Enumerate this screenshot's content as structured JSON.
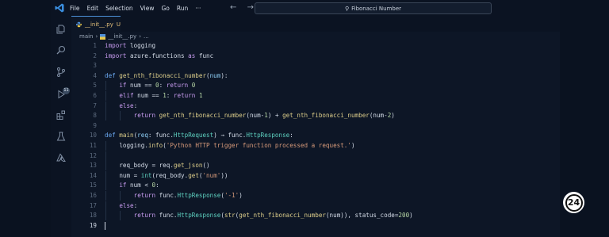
{
  "menu": [
    "File",
    "Edit",
    "Selection",
    "View",
    "Go",
    "Run",
    "···"
  ],
  "nav": {
    "back": "←",
    "forward": "→"
  },
  "search": {
    "text": "Fibonacci Number",
    "icon": "search-icon"
  },
  "activity": {
    "badge": "11",
    "icons": [
      "explorer-icon",
      "search-icon",
      "source-control-icon",
      "run-debug-icon",
      "extensions-icon",
      "testing-icon",
      "azure-icon"
    ]
  },
  "tab": {
    "label": "__init__.py",
    "status": "U"
  },
  "breadcrumb": {
    "folder": "main",
    "file": "__init__.py",
    "tail": "..."
  },
  "editor": {
    "active_line": 19,
    "lines": [
      {
        "n": 1,
        "indent": 0,
        "tokens": [
          [
            "k",
            "import"
          ],
          [
            "o",
            " logging"
          ]
        ]
      },
      {
        "n": 2,
        "indent": 0,
        "tokens": [
          [
            "k",
            "import"
          ],
          [
            "o",
            " azure.functions "
          ],
          [
            "k",
            "as"
          ],
          [
            "o",
            " func"
          ]
        ]
      },
      {
        "n": 3,
        "indent": 0,
        "tokens": []
      },
      {
        "n": 4,
        "indent": 0,
        "tokens": [
          [
            "kb",
            "def"
          ],
          [
            "o",
            " "
          ],
          [
            "f",
            "get_nth_fibonacci_number"
          ],
          [
            "o",
            "("
          ],
          [
            "p",
            "num"
          ],
          [
            "o",
            "):"
          ]
        ]
      },
      {
        "n": 5,
        "indent": 1,
        "tokens": [
          [
            "k",
            "if"
          ],
          [
            "o",
            " num == "
          ],
          [
            "n",
            "0"
          ],
          [
            "o",
            ": "
          ],
          [
            "k",
            "return"
          ],
          [
            "o",
            " "
          ],
          [
            "n",
            "0"
          ]
        ]
      },
      {
        "n": 6,
        "indent": 1,
        "tokens": [
          [
            "k",
            "elif"
          ],
          [
            "o",
            " num == "
          ],
          [
            "n",
            "1"
          ],
          [
            "o",
            ": "
          ],
          [
            "k",
            "return"
          ],
          [
            "o",
            " "
          ],
          [
            "n",
            "1"
          ]
        ]
      },
      {
        "n": 7,
        "indent": 1,
        "tokens": [
          [
            "k",
            "else"
          ],
          [
            "o",
            ":"
          ]
        ]
      },
      {
        "n": 8,
        "indent": 2,
        "tokens": [
          [
            "k",
            "return"
          ],
          [
            "o",
            " "
          ],
          [
            "f",
            "get_nth_fibonacci_number"
          ],
          [
            "o",
            "(num-"
          ],
          [
            "n",
            "1"
          ],
          [
            "o",
            ") + "
          ],
          [
            "f",
            "get_nth_fibonacci_number"
          ],
          [
            "o",
            "(num-"
          ],
          [
            "n",
            "2"
          ],
          [
            "o",
            ")"
          ]
        ]
      },
      {
        "n": 9,
        "indent": 0,
        "tokens": []
      },
      {
        "n": 10,
        "indent": 0,
        "tokens": [
          [
            "kb",
            "def"
          ],
          [
            "o",
            " "
          ],
          [
            "f",
            "main"
          ],
          [
            "o",
            "("
          ],
          [
            "p",
            "req"
          ],
          [
            "o",
            ": func."
          ],
          [
            "t",
            "HttpRequest"
          ],
          [
            "o",
            ") → func."
          ],
          [
            "t",
            "HttpResponse"
          ],
          [
            "o",
            ":"
          ]
        ]
      },
      {
        "n": 11,
        "indent": 1,
        "tokens": [
          [
            "o",
            "logging."
          ],
          [
            "f",
            "info"
          ],
          [
            "o",
            "("
          ],
          [
            "s",
            "'Python HTTP trigger function processed a request.'"
          ],
          [
            "o",
            ")"
          ]
        ]
      },
      {
        "n": 12,
        "indent": 1,
        "tokens": []
      },
      {
        "n": 13,
        "indent": 1,
        "tokens": [
          [
            "o",
            "req_body = req."
          ],
          [
            "f",
            "get_json"
          ],
          [
            "o",
            "()"
          ]
        ]
      },
      {
        "n": 14,
        "indent": 1,
        "tokens": [
          [
            "o",
            "num = "
          ],
          [
            "t",
            "int"
          ],
          [
            "o",
            "(req_body."
          ],
          [
            "f",
            "get"
          ],
          [
            "o",
            "("
          ],
          [
            "s",
            "'num'"
          ],
          [
            "o",
            "))"
          ]
        ]
      },
      {
        "n": 15,
        "indent": 1,
        "tokens": [
          [
            "k",
            "if"
          ],
          [
            "o",
            " num < "
          ],
          [
            "n",
            "0"
          ],
          [
            "o",
            ":"
          ]
        ]
      },
      {
        "n": 16,
        "indent": 2,
        "tokens": [
          [
            "k",
            "return"
          ],
          [
            "o",
            " func."
          ],
          [
            "t",
            "HttpResponse"
          ],
          [
            "o",
            "("
          ],
          [
            "s",
            "'-1'"
          ],
          [
            "o",
            ")"
          ]
        ]
      },
      {
        "n": 17,
        "indent": 1,
        "tokens": [
          [
            "k",
            "else"
          ],
          [
            "o",
            ":"
          ]
        ]
      },
      {
        "n": 18,
        "indent": 2,
        "tokens": [
          [
            "k",
            "return"
          ],
          [
            "o",
            " func."
          ],
          [
            "t",
            "HttpResponse"
          ],
          [
            "o",
            "("
          ],
          [
            "f",
            "str"
          ],
          [
            "o",
            "("
          ],
          [
            "f",
            "get_nth_fibonacci_number"
          ],
          [
            "o",
            "(num)), status_code="
          ],
          [
            "n",
            "200"
          ],
          [
            "o",
            ")"
          ]
        ]
      },
      {
        "n": 19,
        "indent": 0,
        "tokens": []
      }
    ]
  },
  "overlay_badge": "24",
  "colors": {
    "accent": "#4c8fd6",
    "background": "#0d1626"
  }
}
